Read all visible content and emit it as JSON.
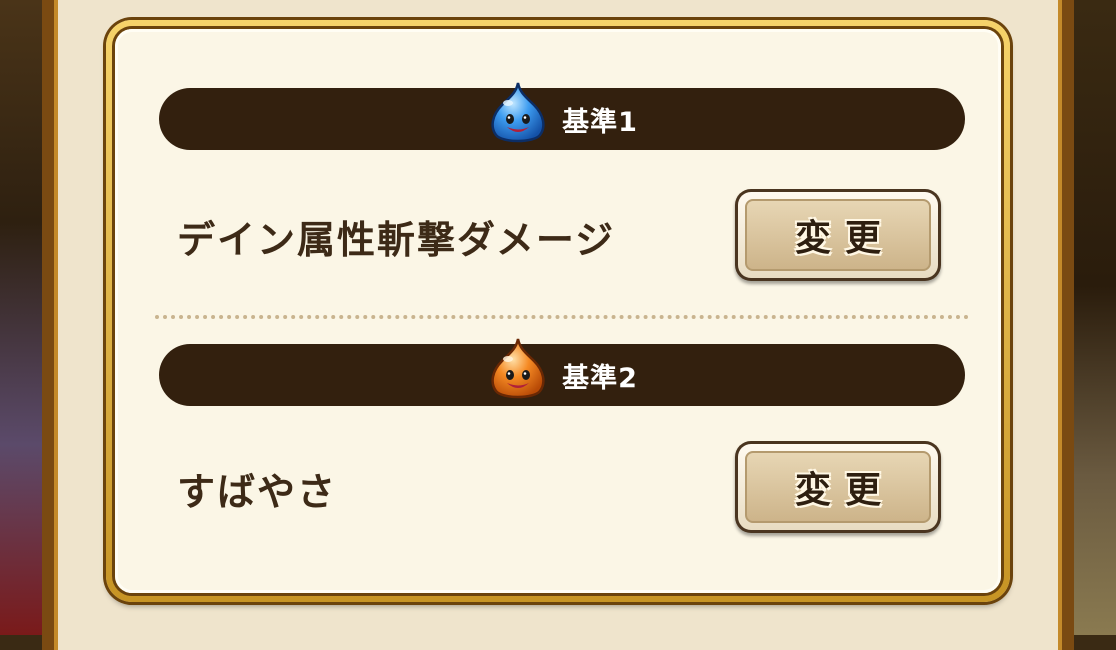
{
  "criteria": [
    {
      "header": "基準1",
      "icon": "blue-slime-icon",
      "icon_color": "#2f8fe6",
      "value": "デイン属性斬撃ダメージ",
      "button_label": "変更"
    },
    {
      "header": "基準2",
      "icon": "orange-slime-icon",
      "icon_color": "#f07a1a",
      "value": "すばやさ",
      "button_label": "変更"
    }
  ],
  "colors": {
    "panel_border_gold": "#d9a93a",
    "header_bar": "#33200e",
    "panel_background": "#fbf6e6",
    "text_brown": "#3d2a17"
  }
}
